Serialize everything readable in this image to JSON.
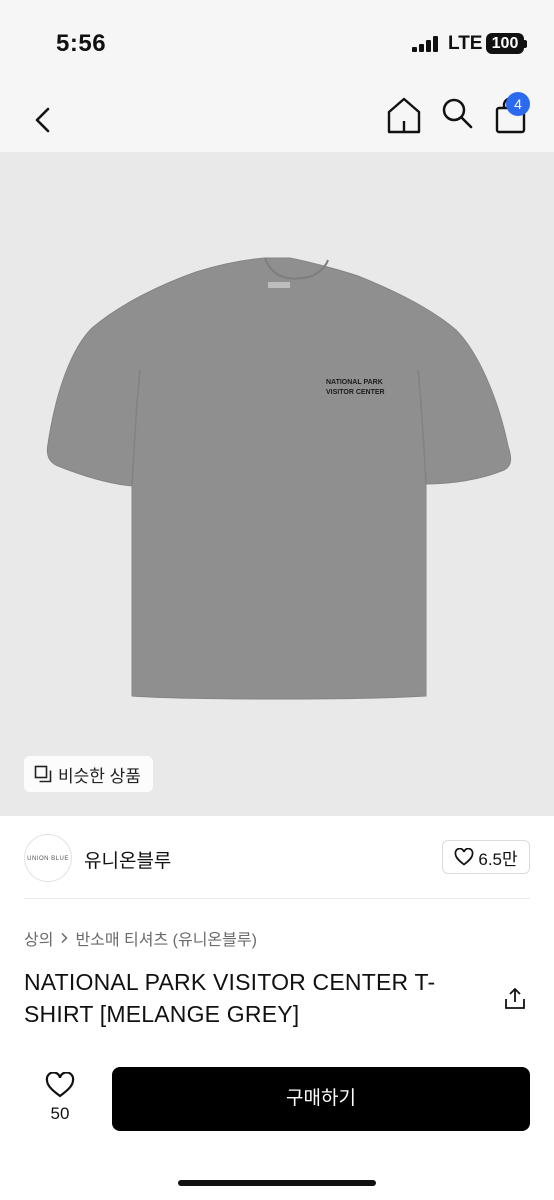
{
  "status_bar": {
    "time": "5:56",
    "network": "LTE",
    "battery": "100"
  },
  "nav": {
    "cart_count": "4"
  },
  "hero": {
    "print_line1": "NATIONAL PARK",
    "print_line2": "VISITOR CENTER",
    "similar_label": "비슷한 상품"
  },
  "brand": {
    "logo_text": "UNION BLUE",
    "name": "유니온블루",
    "likes": "6.5만"
  },
  "breadcrumb": {
    "category": "상의",
    "subcategory": "반소매 티셔츠 (유니온블루)"
  },
  "product": {
    "title": "NATIONAL PARK VISITOR CENTER T-SHIRT [MELANGE GREY]"
  },
  "bottom_bar": {
    "wish_count": "50",
    "buy_label": "구매하기"
  },
  "colors": {
    "accent_badge": "#2b6af0",
    "shirt": "#8f8f90",
    "buy_button": "#000000"
  }
}
